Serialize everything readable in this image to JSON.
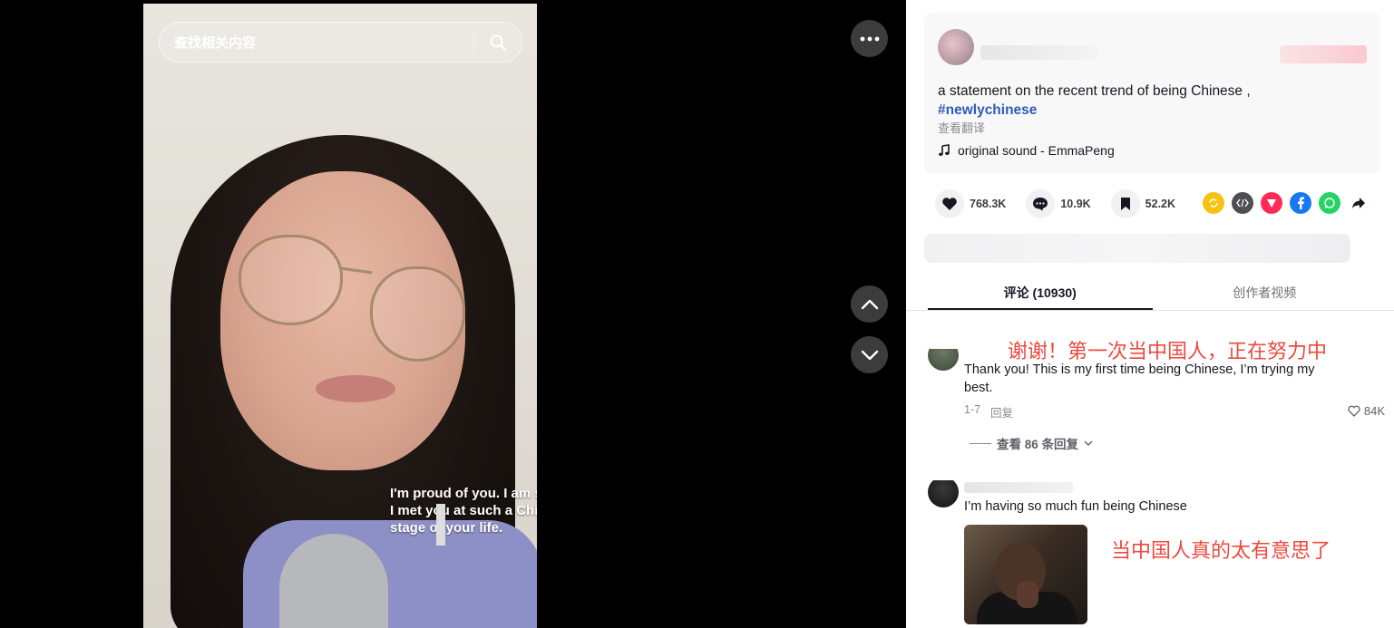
{
  "video": {
    "search_placeholder": "查找相关内容",
    "caption": "I'm proud of you. I am so glad I met you at such a Chinese stage of your life."
  },
  "post": {
    "description": "a statement on the recent trend of being Chinese ,",
    "hashtag": "#newlychinese",
    "translate_link": "查看翻译",
    "music": "original sound - EmmaPeng"
  },
  "stats": {
    "likes": "768.3K",
    "comments": "10.9K",
    "saves": "52.2K"
  },
  "tabs": {
    "comments": "评论 (10930)",
    "creator_videos": "创作者视频"
  },
  "comments": [
    {
      "translation": "谢谢！第一次当中国人，正在努力中",
      "text": "Thank you! This is my first time being Chinese, I’m trying my best.",
      "date": "1-7",
      "reply": "回复",
      "likes": "84K",
      "view_replies": "查看 86 条回复"
    },
    {
      "text": "I’m having so much fun being Chinese",
      "translation": "当中国人真的太有意思了"
    }
  ],
  "colors": {
    "accent_red": "#ec4a3f",
    "hashtag_blue": "#2b5db9"
  }
}
